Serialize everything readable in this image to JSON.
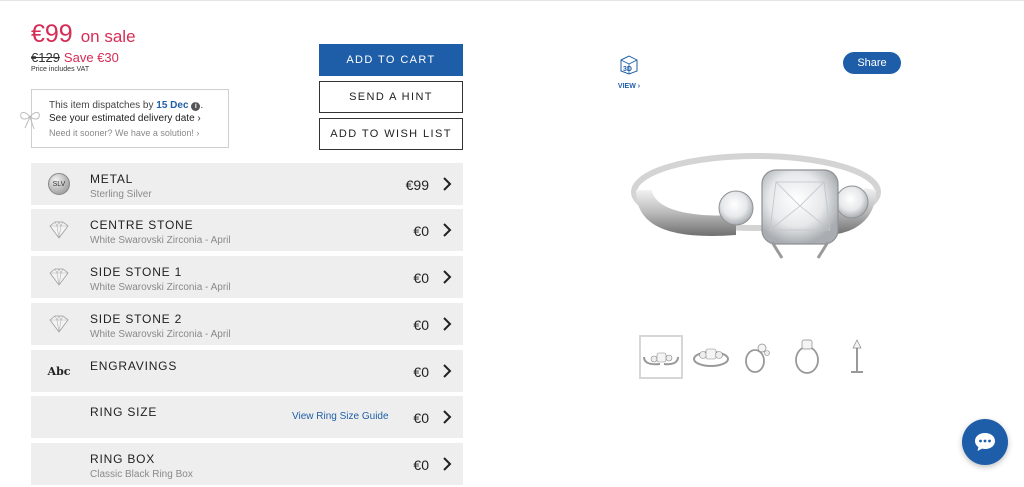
{
  "price": {
    "current": "€99",
    "sale_label": "on sale",
    "original": "€129",
    "savings": "Save €30",
    "vat_note": "Price includes VAT"
  },
  "dispatch": {
    "line1_prefix": "This item dispatches by",
    "date": "15 Dec",
    "info_glyph": "i",
    "line2": "See your estimated delivery date ›",
    "line3": "Need it sooner? We have a solution! ›"
  },
  "buttons": {
    "add_to_cart": "ADD TO CART",
    "send_hint": "SEND A HINT",
    "add_to_wishlist": "ADD TO WISH LIST"
  },
  "options": [
    {
      "icon": "silver-badge-icon",
      "icon_text": "SLV",
      "title": "METAL",
      "subtitle": "Sterling Silver",
      "price": "€99"
    },
    {
      "icon": "diamond-icon",
      "title": "CENTRE STONE",
      "subtitle": "White Swarovski Zirconia - April",
      "price": "€0"
    },
    {
      "icon": "diamond-icon",
      "title": "SIDE STONE 1",
      "subtitle": "White Swarovski Zirconia - April",
      "price": "€0"
    },
    {
      "icon": "diamond-icon",
      "title": "SIDE STONE 2",
      "subtitle": "White Swarovski Zirconia - April",
      "price": "€0"
    },
    {
      "icon": "text-abc-icon",
      "icon_text": "Abc",
      "title": "ENGRAVINGS",
      "subtitle": "",
      "price": "€0"
    },
    {
      "icon": "",
      "title": "RING SIZE",
      "subtitle": "",
      "link": "View Ring Size Guide",
      "price": "€0"
    },
    {
      "icon": "",
      "title": "RING BOX",
      "subtitle": "Classic Black Ring Box",
      "price": "€0"
    }
  ],
  "viewer": {
    "three_d_label": "3D",
    "view_label": "VIEW ›",
    "share_label": "Share",
    "thumbnails": [
      "ring-front-thumb",
      "ring-top-thumb",
      "ring-angle-thumb",
      "ring-side-thumb",
      "ring-profile-thumb"
    ]
  },
  "colors": {
    "accent": "#1e5ea8",
    "sale": "#d62c55",
    "row_bg": "#eeeeee"
  }
}
